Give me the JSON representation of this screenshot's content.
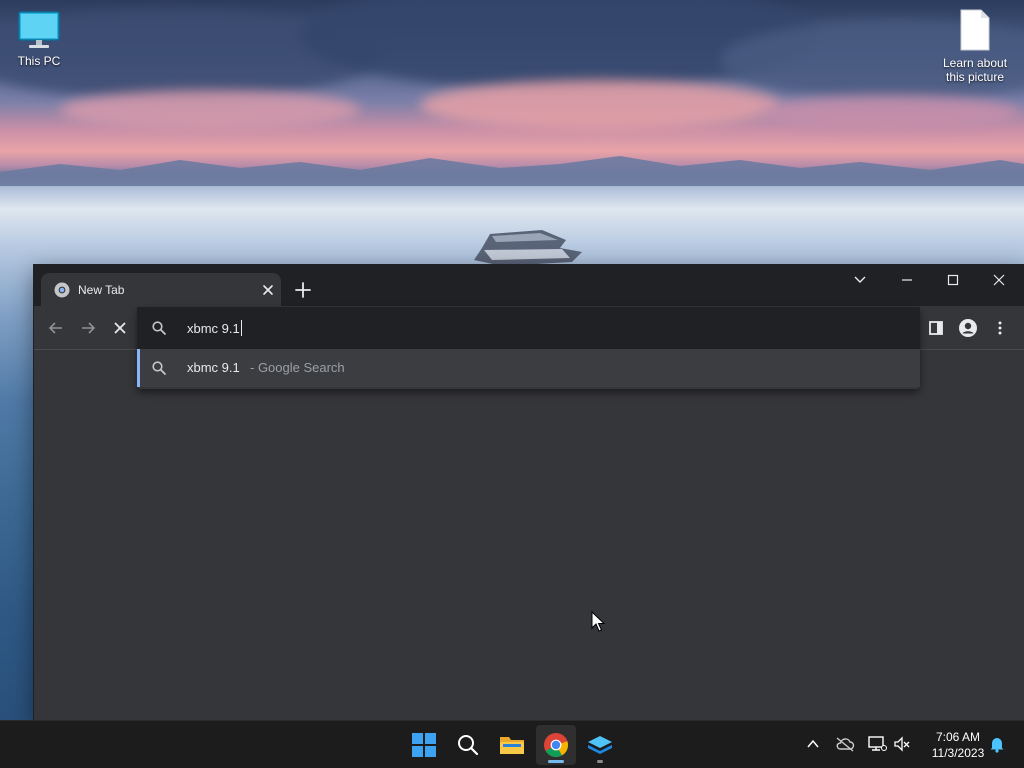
{
  "desktop": {
    "icons": [
      {
        "label": "This PC",
        "icon": "monitor-icon"
      },
      {
        "label": "Learn about this picture",
        "icon": "document-icon"
      }
    ]
  },
  "browser": {
    "tab": {
      "title": "New Tab",
      "favicon": "chrome-icon"
    },
    "omnibox": {
      "value": "xbmc 9.1",
      "suggestion": {
        "query": "xbmc 9.1",
        "description": "- Google Search"
      }
    }
  },
  "taskbar": {
    "clock": {
      "time": "7:06 AM",
      "date": "11/3/2023"
    }
  },
  "colors": {
    "accent": "#8ab4f8",
    "window_bg": "#35363a",
    "titlebar_bg": "#202124",
    "taskbar_bg": "#1c1c1c"
  }
}
